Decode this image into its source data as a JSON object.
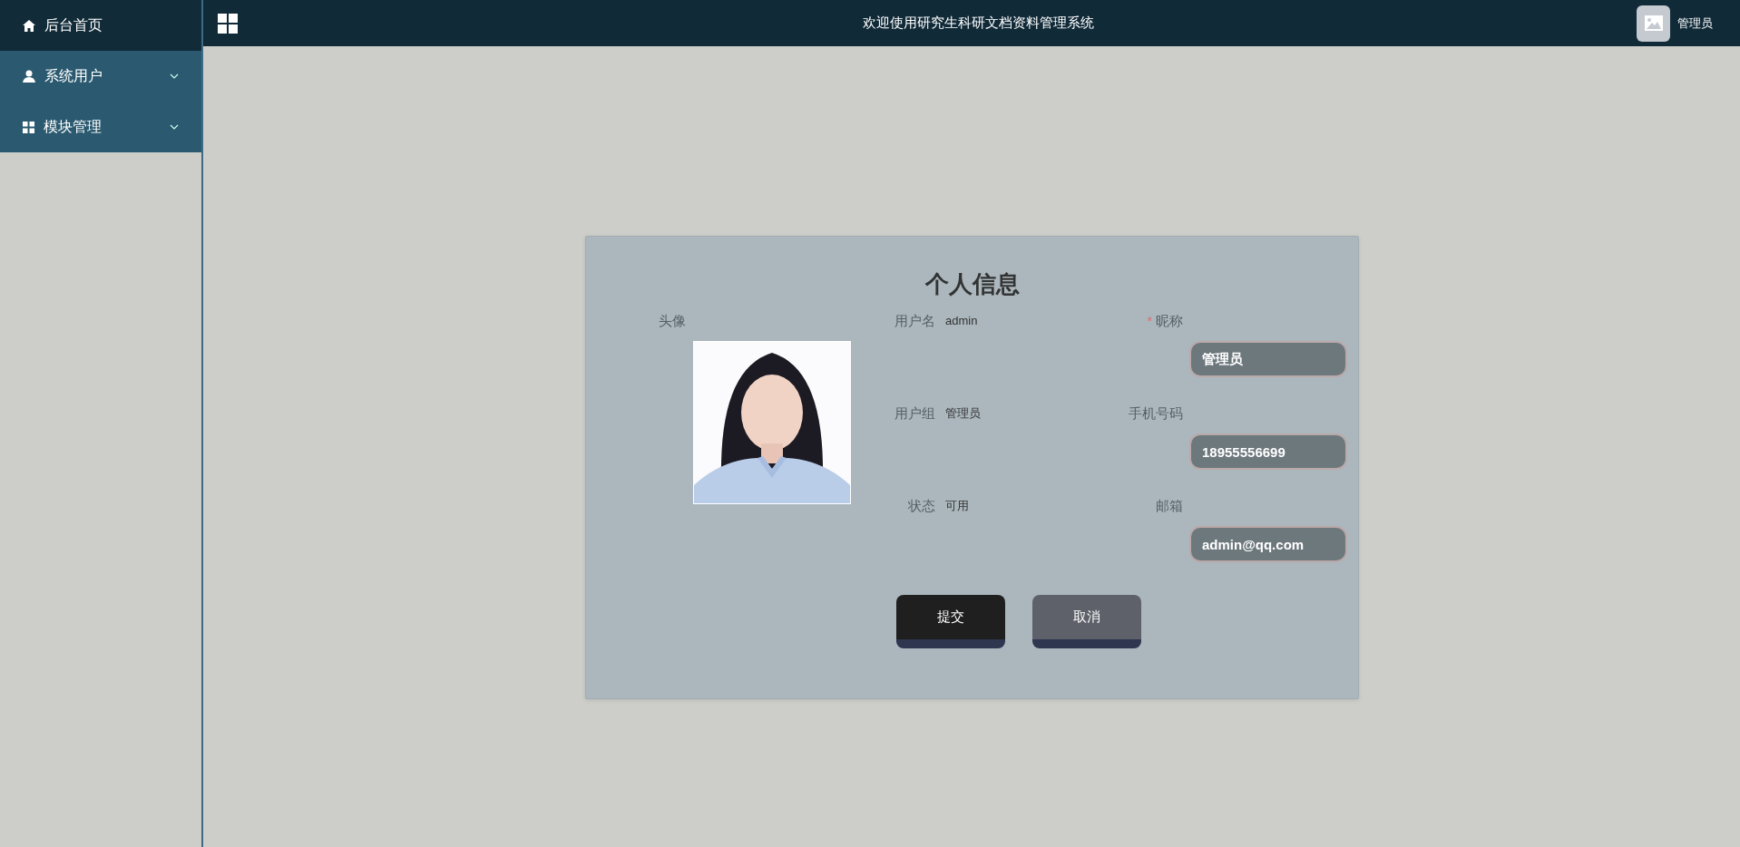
{
  "sidebar": {
    "items": [
      {
        "label": "后台首页",
        "kind": "link",
        "selected": true
      },
      {
        "label": "系统用户",
        "kind": "submenu",
        "selected": false
      },
      {
        "label": "模块管理",
        "kind": "submenu",
        "selected": false
      }
    ]
  },
  "header": {
    "title": "欢迎使用研究生科研文档资料管理系统",
    "user_name": "管理员"
  },
  "form": {
    "title": "个人信息",
    "avatar_label": "头像",
    "required_mark": "*",
    "info_fields": [
      {
        "label": "用户名",
        "value": "admin"
      },
      {
        "label": "用户组",
        "value": "管理员"
      },
      {
        "label": "状态",
        "value": "可用"
      }
    ],
    "input_fields": [
      {
        "label": "昵称",
        "value": "管理员",
        "required": true
      },
      {
        "label": "手机号码",
        "value": "18955556699",
        "required": false
      },
      {
        "label": "邮箱",
        "value": "admin@qq.com",
        "required": false
      }
    ],
    "buttons": [
      {
        "label": "提交",
        "kind": "primary"
      },
      {
        "label": "取消",
        "kind": "secondary"
      }
    ]
  }
}
